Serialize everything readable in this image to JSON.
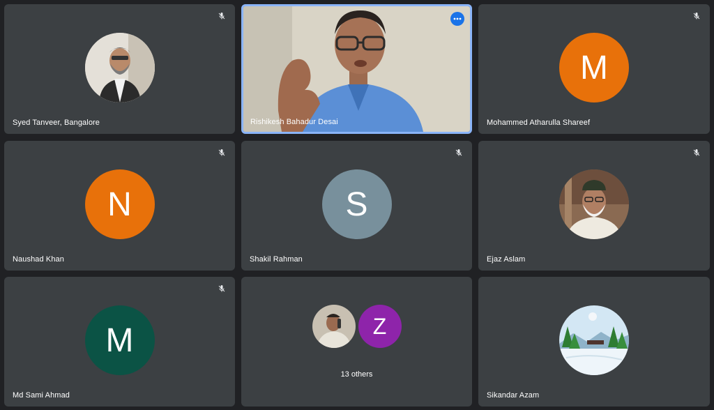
{
  "participants": [
    {
      "name": "Syed Tanveer, Bangalore",
      "type": "photo",
      "muted": true,
      "icon": "person-photo"
    },
    {
      "name": "Rishikesh Bahadur Desai",
      "type": "video",
      "muted": false,
      "active": true
    },
    {
      "name": "Mohammed Atharulla Shareef",
      "type": "initial",
      "initial": "M",
      "color": "#e8710a",
      "muted": true
    },
    {
      "name": "Naushad Khan",
      "type": "initial",
      "initial": "N",
      "color": "#e8710a",
      "muted": true
    },
    {
      "name": "Shakil Rahman",
      "type": "initial",
      "initial": "S",
      "color": "#78909c",
      "muted": true
    },
    {
      "name": "Ejaz Aslam",
      "type": "photo",
      "muted": true,
      "icon": "person-photo"
    },
    {
      "name": "Md Sami Ahmad",
      "type": "initial",
      "initial": "M",
      "color": "#0b5345",
      "muted": true
    },
    {
      "name": "Sikandar Azam",
      "type": "photo",
      "muted": false,
      "icon": "landscape-photo"
    }
  ],
  "others_tile": {
    "label": "13 others",
    "avatars": [
      {
        "type": "photo",
        "icon": "person-photo"
      },
      {
        "type": "initial",
        "initial": "Z",
        "color": "#8e24aa"
      }
    ]
  },
  "colors": {
    "background": "#202124",
    "tile": "#3c4043",
    "active_border": "#8ab4f8",
    "accent": "#1a73e8"
  }
}
